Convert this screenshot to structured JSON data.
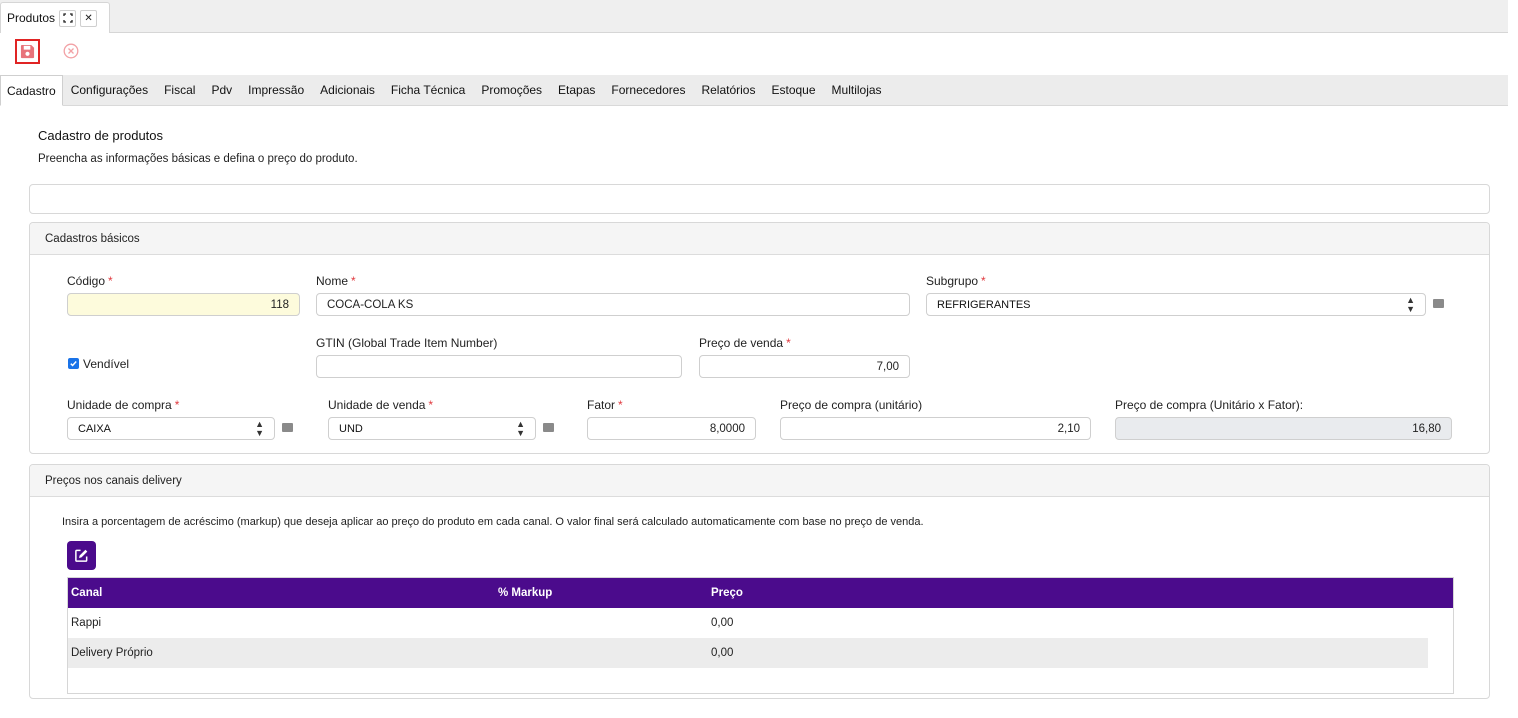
{
  "window": {
    "tab_label": "Produtos",
    "expand_glyph": "⛶",
    "close_glyph": "✕"
  },
  "toolbar": {
    "save_icon": "floppy-disk-icon",
    "cancel_icon": "circle-x-icon"
  },
  "tabs": [
    {
      "label": "Cadastro",
      "active": true
    },
    {
      "label": "Configurações"
    },
    {
      "label": "Fiscal"
    },
    {
      "label": "Pdv"
    },
    {
      "label": "Impressão"
    },
    {
      "label": "Adicionais"
    },
    {
      "label": "Ficha Técnica"
    },
    {
      "label": "Promoções"
    },
    {
      "label": "Etapas"
    },
    {
      "label": "Fornecedores"
    },
    {
      "label": "Relatórios"
    },
    {
      "label": "Estoque"
    },
    {
      "label": "Multilojas"
    }
  ],
  "page": {
    "title": "Cadastro de produtos",
    "subtitle": "Preencha as informações básicas e defina o preço do produto."
  },
  "basic": {
    "header": "Cadastros básicos",
    "required_mark": "*",
    "codigo": {
      "label": "Código",
      "value": "118"
    },
    "nome": {
      "label": "Nome",
      "value": "COCA-COLA KS"
    },
    "subgrupo": {
      "label": "Subgrupo",
      "value": "REFRIGERANTES"
    },
    "vendivel": {
      "label": "Vendível",
      "checked": true
    },
    "gtin": {
      "label": "GTIN (Global Trade Item Number)",
      "value": ""
    },
    "preco_venda": {
      "label": "Preço de venda",
      "value": "7,00"
    },
    "unidade_compra": {
      "label": "Unidade de compra",
      "value": "CAIXA"
    },
    "unidade_venda": {
      "label": "Unidade de venda",
      "value": "UND"
    },
    "fator": {
      "label": "Fator",
      "value": "8,0000"
    },
    "preco_compra_unit": {
      "label": "Preço de compra (unitário)",
      "value": "2,10"
    },
    "preco_compra_total": {
      "label": "Preço de compra (Unitário x Fator):",
      "value": "16,80"
    }
  },
  "delivery": {
    "header": "Preços nos canais delivery",
    "description": "Insira a porcentagem de acréscimo (markup) que deseja aplicar ao preço do produto em cada canal. O valor final será calculado automaticamente com base no preço de venda.",
    "columns": [
      "Canal",
      "% Markup",
      "Preço"
    ],
    "rows": [
      {
        "canal": "Rappi",
        "markup": "",
        "preco": "0,00"
      },
      {
        "canal": "Delivery Próprio",
        "markup": "",
        "preco": "0,00"
      }
    ]
  },
  "colors": {
    "accent_purple": "#4b0b8c",
    "required_red": "#e0393e",
    "save_red": "#e02424",
    "checkbox_blue": "#1a73e8"
  }
}
